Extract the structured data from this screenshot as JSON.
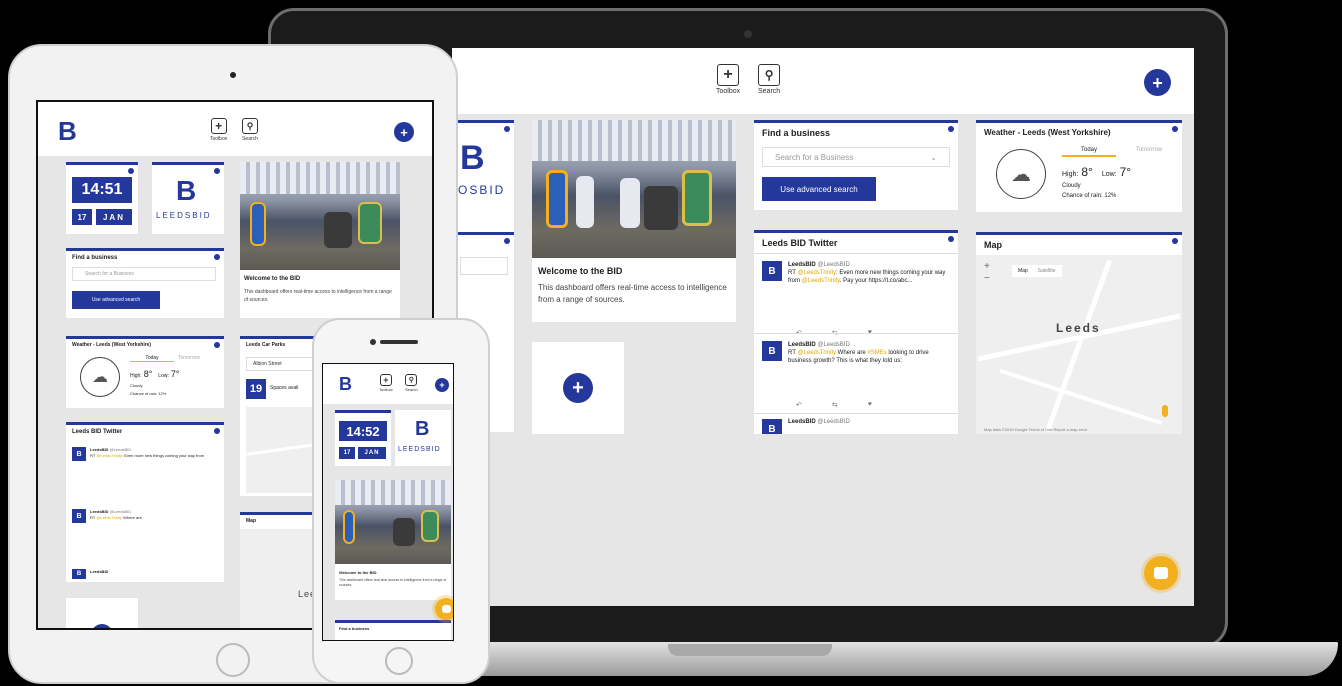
{
  "toolbar": {
    "toolbox_label": "Toolbox",
    "search_label": "Search",
    "toolbox_icon": "plus-square-icon",
    "search_icon": "magnifier-icon"
  },
  "brand": {
    "letter": "B",
    "name": "LEEDSBID",
    "accent": "#24389c",
    "highlight": "#f2b01e"
  },
  "clock": {
    "time_tablet": "14:51",
    "time_phone": "14:52",
    "day": "17",
    "month": "JAN"
  },
  "welcome": {
    "title": "Welcome to the BID",
    "body": "This dashboard offers real-time access to intelligence from a range of sources."
  },
  "find_business": {
    "title": "Find a business",
    "placeholder": "Search for a Business",
    "button": "Use advanced search"
  },
  "weather": {
    "title": "Weather - Leeds (West Yorkshire)",
    "tab_today": "Today",
    "tab_tomorrow": "Tomorrow",
    "high_label": "High:",
    "high": "8°",
    "low_label": "Low:",
    "low": "7°",
    "condition": "Cloudy",
    "rain": "Chance of rain: 12%"
  },
  "twitter": {
    "title": "Leeds BID Twitter",
    "tweets": [
      {
        "user": "LeedsBID",
        "handle": "@LeedsBID",
        "text_a": "RT ",
        "mention": "@LeedsTrinity",
        "text_b": ": Even more new things coming your way from ",
        "mention2": "@LeedsTrinity",
        "text_c": ". Pay your ",
        "text_d": " https://t.co/abc..."
      },
      {
        "user": "LeedsBID",
        "handle": "@LeedsBID",
        "text_a": "RT ",
        "mention": "@LeedsTrinity",
        "text_b": " Where are ",
        "mention2": "#SMEs",
        "text_c": " looking to drive business growth? This is what they told us: ",
        "text_d": ""
      },
      {
        "user": "LeedsBID",
        "handle": "@LeedsBID",
        "text_a": "",
        "mention": "",
        "text_b": "",
        "mention2": "",
        "text_c": "",
        "text_d": ""
      }
    ],
    "reply_icon": "reply-icon",
    "retweet_icon": "retweet-icon",
    "like_icon": "heart-icon"
  },
  "map": {
    "title": "Map",
    "tab_map": "Map",
    "tab_satellite": "Satellite",
    "city": "Leeds",
    "zoom_in": "+",
    "zoom_out": "−",
    "footer": "Map data ©2019 Google   Terms of Use   Report a map error"
  },
  "car_parks": {
    "title": "Leeds Car Parks",
    "selected": "Albion Street",
    "spaces": "19",
    "spaces_label": "Spaces avail"
  },
  "phone_next": {
    "title": "Find a business"
  },
  "add_widget": "+",
  "fab_label": "+"
}
